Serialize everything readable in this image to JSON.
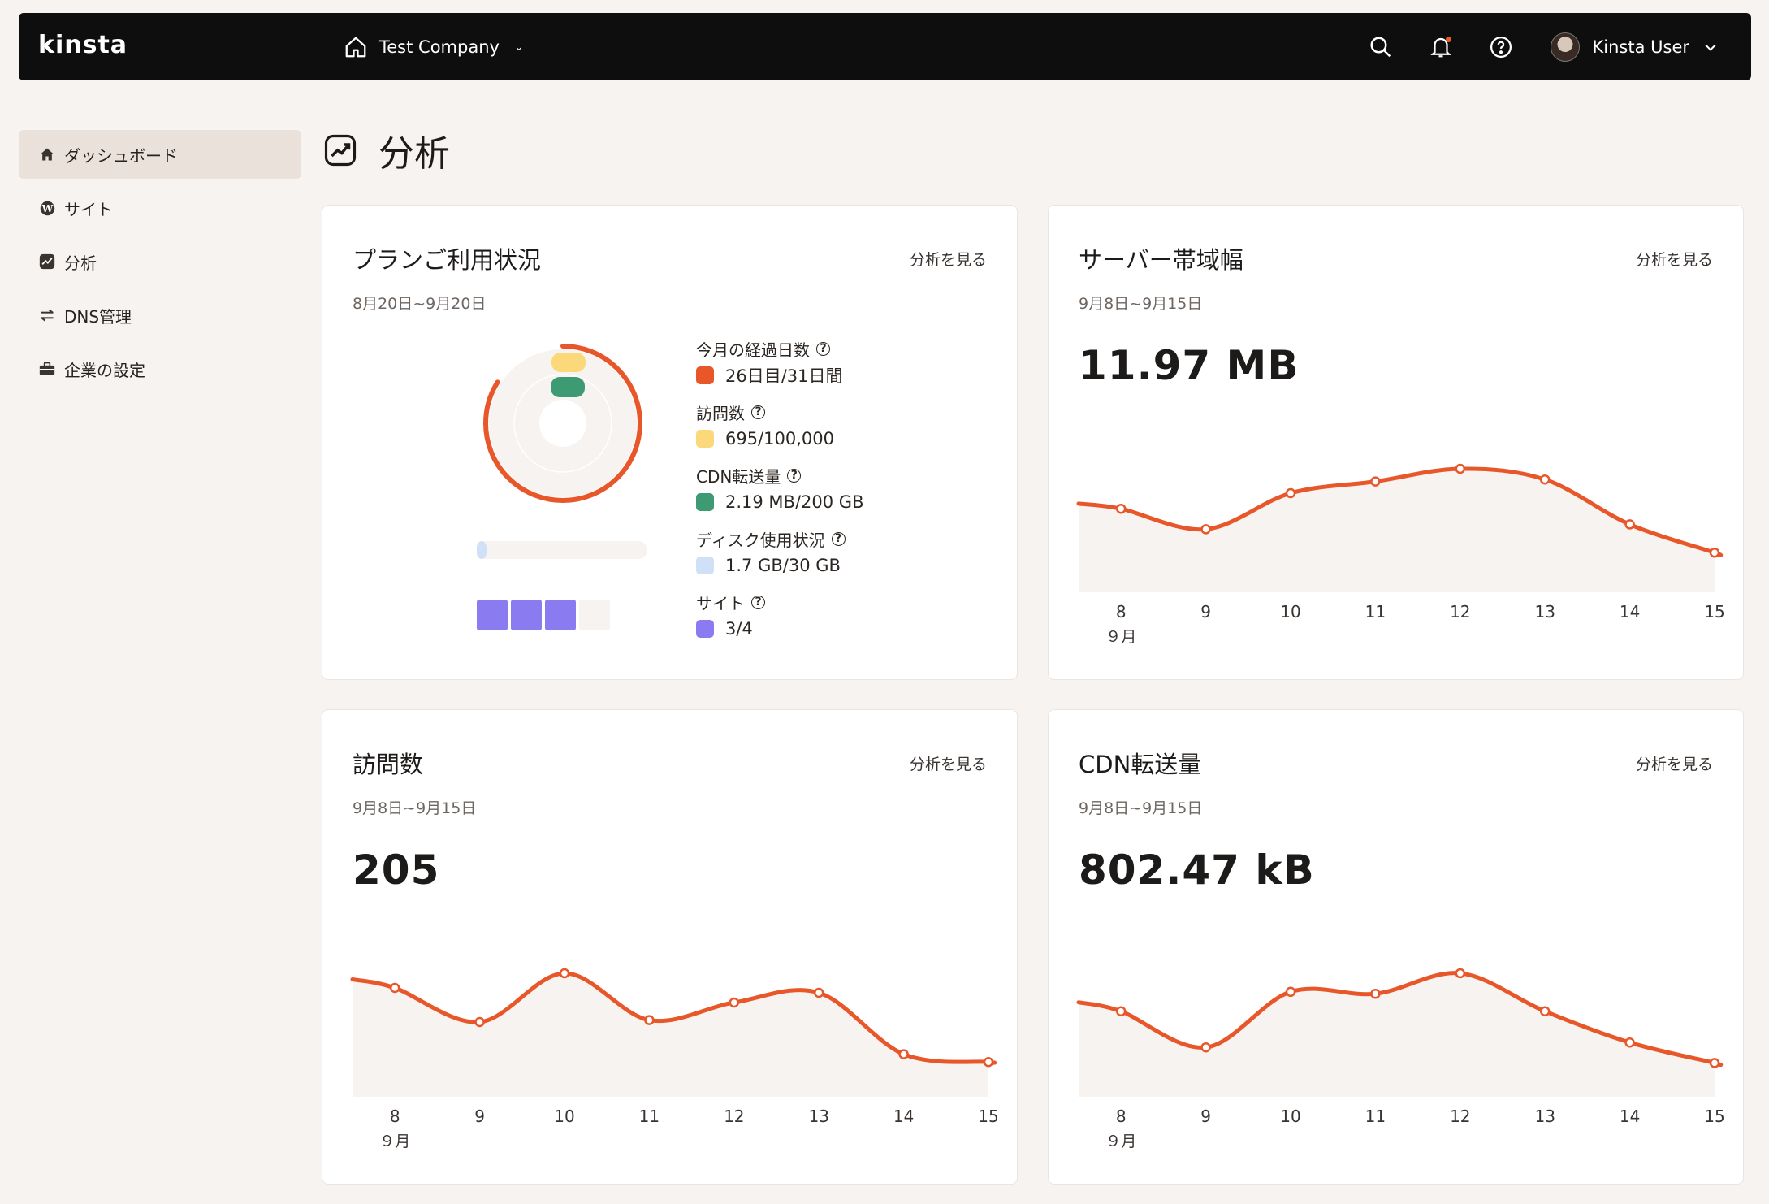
{
  "topbar": {
    "logo": "kinsta",
    "company": "Test Company",
    "user_name": "Kinsta User"
  },
  "sidebar": {
    "items": [
      {
        "label": "ダッシュボード",
        "icon": "home-icon"
      },
      {
        "label": "サイト",
        "icon": "wordpress-icon"
      },
      {
        "label": "分析",
        "icon": "analytics-icon"
      },
      {
        "label": "DNS管理",
        "icon": "dns-icon"
      },
      {
        "label": "企業の設定",
        "icon": "briefcase-icon"
      }
    ]
  },
  "page": {
    "title": "分析"
  },
  "cards": {
    "plan": {
      "title": "プランご利用状況",
      "link": "分析を見る",
      "range": "8月20日~9月20日",
      "legend": [
        {
          "label": "今月の経過日数",
          "value": "26日目/31日間",
          "color": "#e8572a"
        },
        {
          "label": "訪問数",
          "value": "695/100,000",
          "color": "#fbd97a"
        },
        {
          "label": "CDN転送量",
          "value": "2.19 MB/200 GB",
          "color": "#3e9a72"
        },
        {
          "label": "ディスク使用状況",
          "value": "1.7 GB/30 GB",
          "color": "#cfe0f7"
        },
        {
          "label": "サイト",
          "value": "3/4",
          "color": "#8b7bf0"
        }
      ],
      "days_fraction": 0.839,
      "disk_fraction": 0.057,
      "sites_used": 3,
      "sites_total": 4
    },
    "bandwidth": {
      "title": "サーバー帯域幅",
      "link": "分析を見る",
      "range": "9月8日~9月15日",
      "value": "11.97 MB"
    },
    "visits": {
      "title": "訪問数",
      "link": "分析を見る",
      "range": "9月8日~9月15日",
      "value": "205"
    },
    "cdn": {
      "title": "CDN転送量",
      "link": "分析を見る",
      "range": "9月8日~9月15日",
      "value": "802.47 kB"
    }
  },
  "chart_data": [
    {
      "type": "area",
      "x": [
        "8",
        "9",
        "10",
        "11",
        "12",
        "13",
        "14",
        "15"
      ],
      "x_sublabel": "９月",
      "series": [
        {
          "values": [
            0.69,
            0.48,
            0.85,
            0.97,
            1.1,
            0.99,
            0.53,
            0.24
          ]
        }
      ],
      "ylim": [
        0,
        1.2
      ]
    },
    {
      "type": "area",
      "x": [
        "8",
        "9",
        "10",
        "11",
        "12",
        "13",
        "14",
        "15"
      ],
      "x_sublabel": "９月",
      "series": [
        {
          "values": [
            0.95,
            0.6,
            1.1,
            0.62,
            0.8,
            0.9,
            0.27,
            0.19
          ]
        }
      ],
      "ylim": [
        0,
        1.2
      ]
    },
    {
      "type": "area",
      "x": [
        "8",
        "9",
        "10",
        "11",
        "12",
        "13",
        "14",
        "15"
      ],
      "x_sublabel": "９月",
      "series": [
        {
          "values": [
            0.71,
            0.34,
            0.91,
            0.89,
            1.1,
            0.71,
            0.39,
            0.18
          ]
        }
      ],
      "ylim": [
        0,
        1.2
      ]
    }
  ],
  "colors": {
    "accent": "#e8572a",
    "area_fill": "#f7f3f0",
    "topbar": "#0e0e0e",
    "page_bg": "#f7f3f0"
  }
}
